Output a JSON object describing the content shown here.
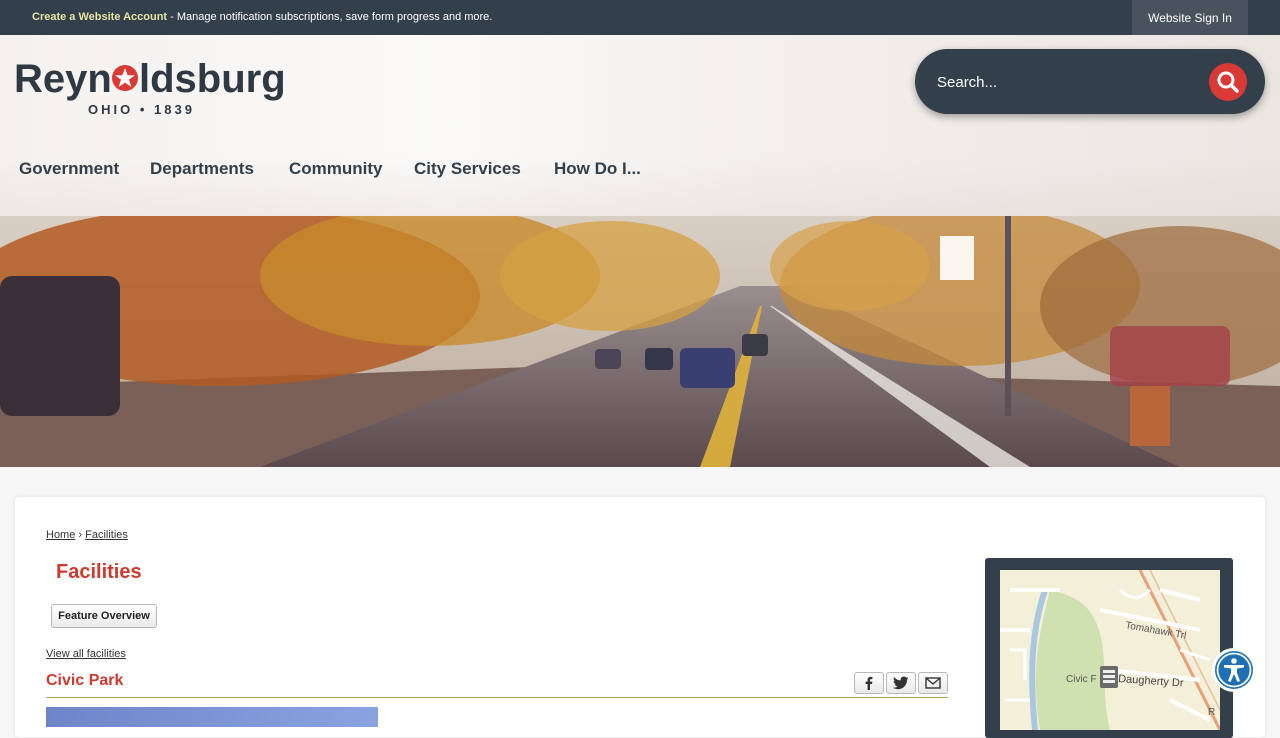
{
  "topbar": {
    "create_account": "Create a Website Account",
    "message": " - Manage notification subscriptions, save form progress and more.",
    "sign_in": "Website Sign In"
  },
  "logo": {
    "name": "Reynoldsburg",
    "tagline": "OHIO • 1839"
  },
  "search": {
    "placeholder": "Search..."
  },
  "nav": {
    "items": [
      "Government",
      "Departments",
      "Community",
      "City Services",
      "How Do I..."
    ]
  },
  "breadcrumb": {
    "home": "Home",
    "sep": " › ",
    "current": "Facilities"
  },
  "page": {
    "title": "Facilities",
    "feature_button": "Feature Overview",
    "view_all": "View all facilities",
    "facility_name": "Civic Park"
  },
  "map": {
    "labels": [
      "Tomahawk Trl",
      "Civic F",
      "Daugherty Dr",
      "R"
    ]
  },
  "colors": {
    "dark": "#333f4a",
    "accent_red": "#cd3a2f",
    "search_red": "#d93a35"
  },
  "icons": [
    "search-icon",
    "facebook-icon",
    "twitter-icon",
    "email-icon",
    "accessibility-icon"
  ]
}
